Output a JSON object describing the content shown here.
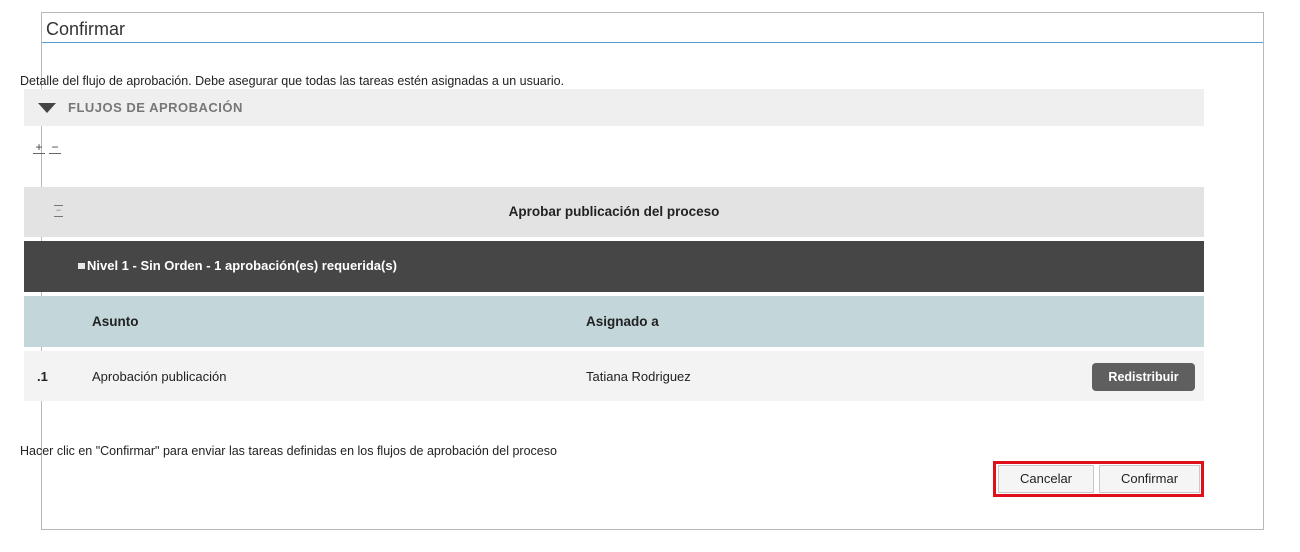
{
  "dialog": {
    "title": "Confirmar",
    "description": "Detalle del flujo de aprobación. Debe asegurar que todas las tareas estén asignadas a un usuario."
  },
  "flows": {
    "section_label": "FLUJOS DE APROBACIÓN",
    "expand_all_symbol": "+",
    "collapse_all_symbol": "−",
    "process": {
      "title": "Aprobar publicación del proceso",
      "collapse_symbol": "−"
    },
    "level": {
      "label": "Nivel 1 - Sin Orden - 1 aprobación(es) requerida(s)"
    },
    "table": {
      "columns": [
        "Asunto",
        "Asignado a"
      ],
      "rows": [
        {
          "index": ".1",
          "subject": "Aprobación publicación",
          "assignee": "Tatiana Rodriguez",
          "action_label": "Redistribuir"
        }
      ]
    }
  },
  "footer": {
    "note": "Hacer clic en \"Confirmar\" para enviar las tareas definidas en los flujos de aprobación del proceso",
    "cancel_label": "Cancelar",
    "confirm_label": "Confirmar"
  },
  "colors": {
    "title_rule": "#5b9bd5",
    "level_bar": "#464646",
    "table_header": "#c3d6da",
    "highlight_border": "#e0101a"
  }
}
